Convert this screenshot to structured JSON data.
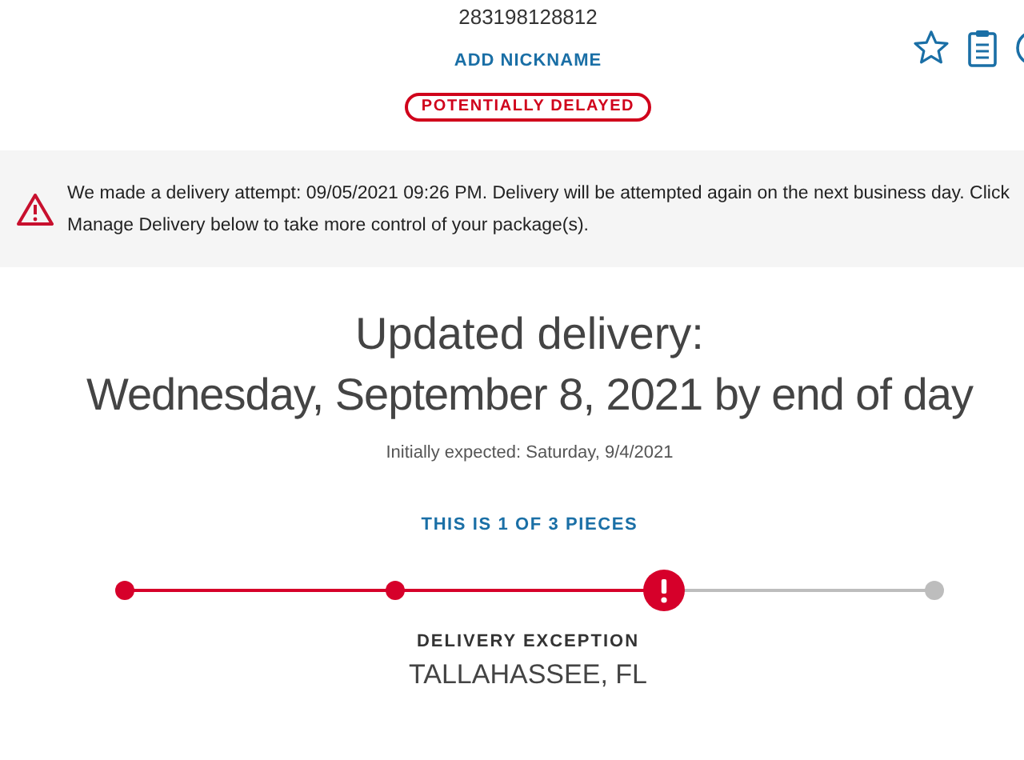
{
  "tracking_number": "283198128812",
  "nickname_link": "ADD NICKNAME",
  "status_badge": "POTENTIALLY DELAYED",
  "alert": {
    "message": "We made a delivery attempt: 09/05/2021 09:26 PM. Delivery will be attempted again on the next business day. Click Manage Delivery below to take more control of your package(s)."
  },
  "delivery": {
    "heading": "Updated delivery:",
    "date": "Wednesday, September 8, 2021 by end of day",
    "initially_expected": "Initially expected: Saturday, 9/4/2021"
  },
  "pieces_link": "THIS IS 1 OF 3 PIECES",
  "progress": [
    {
      "kind": "done"
    },
    {
      "kind": "done"
    },
    {
      "kind": "exception"
    },
    {
      "kind": "pending"
    }
  ],
  "status": {
    "label": "DELIVERY EXCEPTION",
    "location": "TALLAHASSEE, FL"
  }
}
